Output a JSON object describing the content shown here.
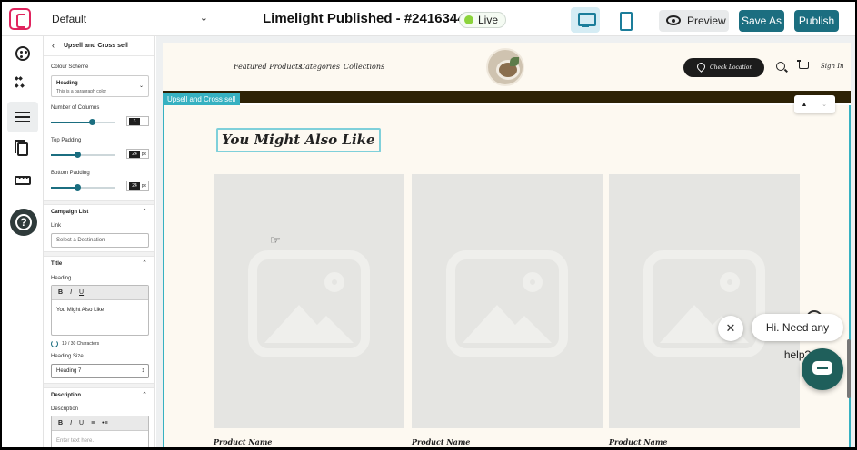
{
  "topbar": {
    "page_select": "Default",
    "title": "Limelight Published - #24163441",
    "live": "Live",
    "preview": "Preview",
    "save_as": "Save As",
    "publish": "Publish"
  },
  "panel": {
    "header": "Upsell and Cross sell",
    "colour_scheme_label": "Colour Scheme",
    "colour_scheme_heading": "Heading",
    "colour_scheme_sub": "This is a paragraph color",
    "columns_label": "Number of Columns",
    "columns_value": "3",
    "columns_level": 0.65,
    "top_padding_label": "Top Padding",
    "top_padding_value": "24",
    "top_padding_unit": "px",
    "top_padding_level": 0.42,
    "bottom_padding_label": "Bottom Padding",
    "bottom_padding_value": "24",
    "bottom_padding_unit": "px",
    "bottom_padding_level": 0.42,
    "campaign_list_label": "Campaign List",
    "link_label": "Link",
    "link_placeholder": "Select a Destination",
    "title_label": "Title",
    "heading_label": "Heading",
    "heading_text": "You Might Also Like",
    "heading_counter": "19 / 30 Characters",
    "heading_size_label": "Heading Size",
    "heading_size_value": "Heading 7",
    "description_section": "Description",
    "description_label": "Description",
    "description_placeholder": "Enter text here.",
    "bold": "B",
    "italic": "I",
    "underline": "U"
  },
  "site": {
    "nav": [
      "Featured Products",
      "Categories",
      "Collections"
    ],
    "check_location": "Check Location",
    "sign_in": "Sign In",
    "section_tag": "Upsell and Cross sell",
    "heading": "You Might Also Like",
    "products": [
      "Product Name",
      "Product Name",
      "Product Name"
    ]
  },
  "chat": {
    "message": "Hi. Need any help?"
  },
  "colors": {
    "accent": "#1b6e80",
    "live_dot": "#8bd33b",
    "section_outline": "#36b1c1",
    "header_dark_bar": "#2d2206"
  }
}
